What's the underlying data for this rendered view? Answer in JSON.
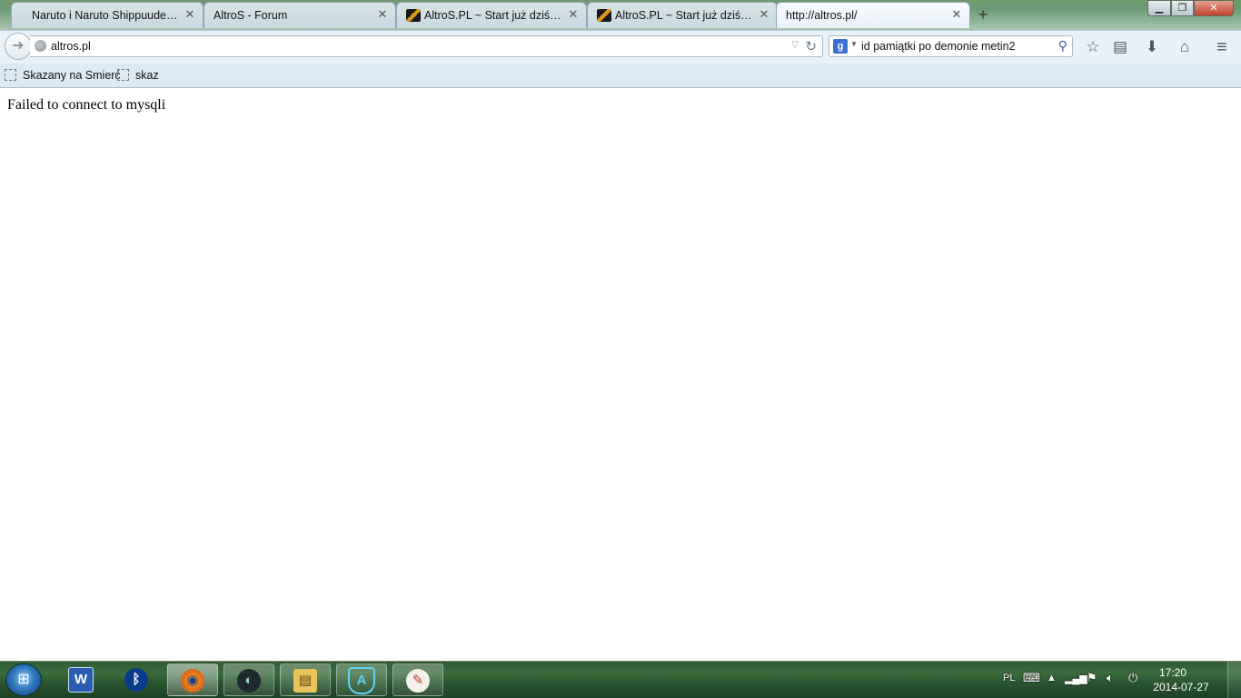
{
  "browser": {
    "tabs": [
      {
        "title": "Naruto i Naruto Shippuuden - ...",
        "active": false,
        "favicon": false
      },
      {
        "title": "AltroS - Forum",
        "active": false,
        "favicon": false
      },
      {
        "title": "AltroS.PL ~ Start już dziś o ...",
        "active": false,
        "favicon": true
      },
      {
        "title": "AltroS.PL ~ Start już dziś o ...",
        "active": false,
        "favicon": true
      },
      {
        "title": "http://altros.pl/",
        "active": true,
        "favicon": false
      }
    ],
    "close_glyph": "✕",
    "new_tab_glyph": "+",
    "window_controls": {
      "minimize": "▁",
      "maximize": "❐",
      "close": "✕"
    },
    "url": "altros.pl",
    "search_engine_glyph": "g",
    "search_query": "id pamiątki po demonie metin2",
    "bookmarks": [
      {
        "label": "Skazany na Smierć"
      },
      {
        "label": "skaz"
      }
    ]
  },
  "page": {
    "message": "Failed to connect to mysqli"
  },
  "taskbar": {
    "apps": [
      {
        "name": "word",
        "glyph": "W",
        "state": "pinned"
      },
      {
        "name": "bluetooth",
        "glyph": "ᛒ",
        "state": "pinned"
      },
      {
        "name": "firefox",
        "glyph": "◉",
        "state": "active"
      },
      {
        "name": "media",
        "glyph": "◐",
        "state": "running"
      },
      {
        "name": "explorer",
        "glyph": "▤",
        "state": "running"
      },
      {
        "name": "shield",
        "glyph": "A",
        "state": "running"
      },
      {
        "name": "paint",
        "glyph": "✎",
        "state": "running"
      }
    ],
    "language": "PL",
    "clock_time": "17:20",
    "clock_date": "2014-07-27"
  }
}
